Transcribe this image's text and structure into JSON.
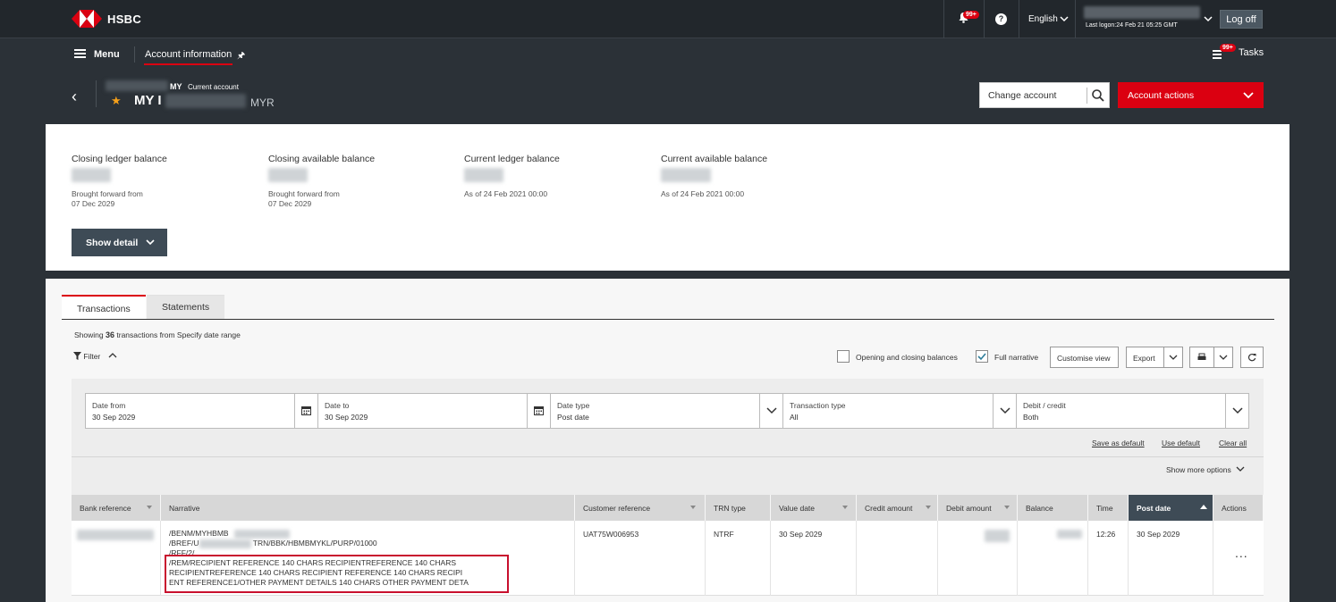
{
  "brand": {
    "name": "HSBC",
    "color": "#db0011"
  },
  "topbar": {
    "notifications_badge": "99+",
    "help_label": "?",
    "language": "English",
    "last_logon": "Last logon:24 Feb 21 05:25 GMT",
    "logoff_label": "Log off"
  },
  "navbar": {
    "menu_label": "Menu",
    "tab_label": "Account information",
    "tasks_badge": "99+",
    "tasks_label": "Tasks"
  },
  "account": {
    "country": "MY",
    "type": "Current account",
    "name_prefix": "MY I",
    "currency": "MYR",
    "change_account_label": "Change account",
    "actions_label": "Account actions"
  },
  "balances": [
    {
      "title": "Closing ledger balance",
      "sub1": "Brought forward from",
      "sub2": "07 Dec 2029"
    },
    {
      "title": "Closing available balance",
      "sub1": "Brought forward from",
      "sub2": "07 Dec 2029"
    },
    {
      "title": "Current ledger balance",
      "sub1": "As of 24 Feb 2021 00:00",
      "sub2": ""
    },
    {
      "title": "Current available balance",
      "sub1": "As of 24 Feb 2021 00:00",
      "sub2": ""
    }
  ],
  "show_detail_label": "Show detail",
  "tabs": {
    "transactions": "Transactions",
    "statements": "Statements"
  },
  "showing": {
    "prefix": "Showing",
    "count": "36",
    "suffix": "transactions from Specify date range"
  },
  "filter_label": "Filter",
  "toolbar": {
    "opening_closing_label": "Opening and closing balances",
    "full_narrative_label": "Full narrative",
    "customise_label": "Customise view",
    "export_label": "Export"
  },
  "filters": {
    "date_from": {
      "label": "Date from",
      "value": "30 Sep 2029"
    },
    "date_to": {
      "label": "Date to",
      "value": "30 Sep 2029"
    },
    "date_type": {
      "label": "Date type",
      "value": "Post date"
    },
    "transaction_type": {
      "label": "Transaction type",
      "value": "All"
    },
    "debit_credit": {
      "label": "Debit / credit",
      "value": "Both"
    },
    "save_default": "Save as default",
    "use_default": "Use default",
    "clear_all": "Clear all",
    "show_more": "Show more options"
  },
  "table": {
    "headers": {
      "bank_reference": "Bank reference",
      "narrative": "Narrative",
      "customer_reference": "Customer reference",
      "trn_type": "TRN type",
      "value_date": "Value date",
      "credit_amount": "Credit amount",
      "debit_amount": "Debit amount",
      "balance": "Balance",
      "time": "Time",
      "post_date": "Post date",
      "actions": "Actions"
    },
    "row": {
      "narrative_lines": [
        "/BENM/MYHBMB",
        "/BREF/U",
        "/RFF/2/",
        "/REM/RECIPIENT REFERENCE 140 CHARS RECIPIENTREFERENCE 140 CHARS",
        "RECIPIENTREFERENCE 140 CHARS RECIPIENT REFERENCE 140 CHARS RECIPI",
        "ENT REFERENCE1/OTHER PAYMENT DETAILS 140 CHARS OTHER PAYMENT DETA"
      ],
      "bref_suffix": "TRN/BBK/HBMBMYKL/PURP/01000",
      "customer_reference": "UAT75W006953",
      "trn_type": "NTRF",
      "value_date": "30 Sep 2029",
      "time": "12:26",
      "post_date": "30 Sep 2029",
      "actions": "..."
    }
  }
}
